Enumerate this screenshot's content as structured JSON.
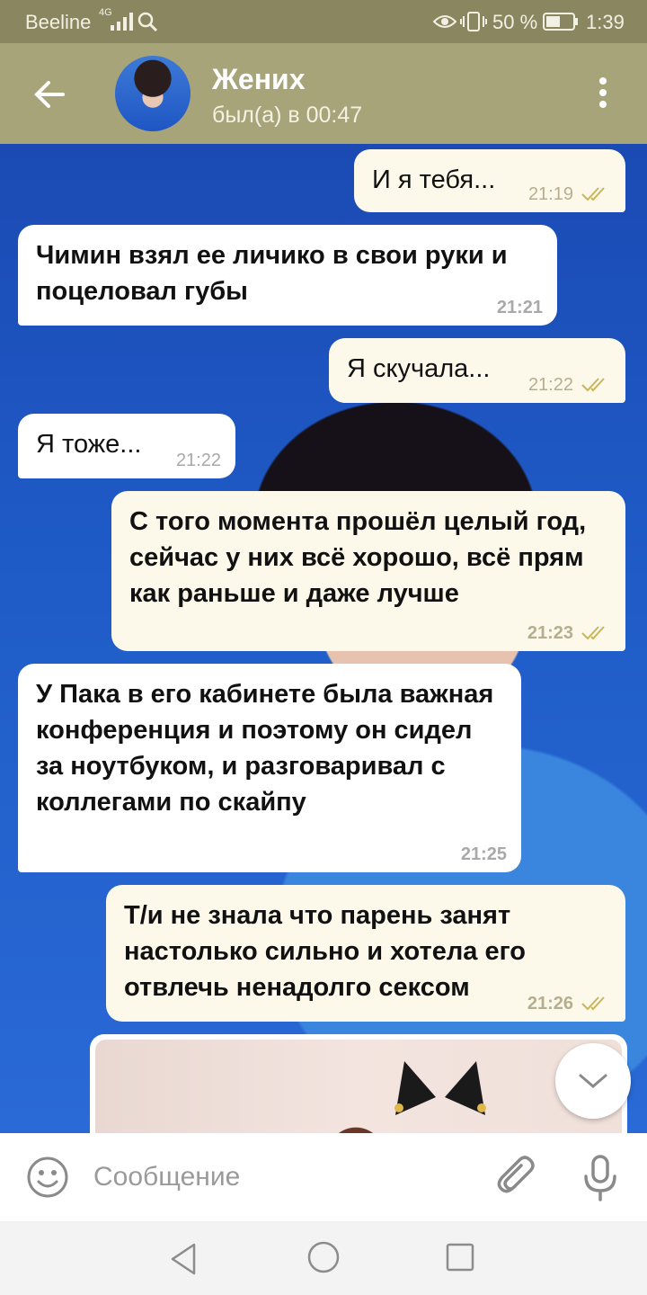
{
  "status_bar": {
    "carrier": "Beeline",
    "network": "4G",
    "battery": "50 %",
    "time": "1:39"
  },
  "header": {
    "name": "Жених",
    "status": "был(а) в 00:47"
  },
  "messages": [
    {
      "side": "out",
      "text": "И я тебя...",
      "time": "21:19",
      "bold": false
    },
    {
      "side": "in",
      "text": "Чимин взял ее личико в свои руки и поцеловал губы",
      "time": "21:21",
      "bold": true
    },
    {
      "side": "out",
      "text": "Я скучала...",
      "time": "21:22",
      "bold": false
    },
    {
      "side": "in",
      "text": "Я тоже...",
      "time": "21:22",
      "bold": false
    },
    {
      "side": "out",
      "text": "С того момента прошёл целый год, сейчас у них всё хорошо, всё прям как раньше и даже лучше",
      "time": "21:23",
      "bold": true
    },
    {
      "side": "in",
      "text": "У Пака в его кабинете была важная конференция и поэтому он сидел за ноутбуком, и разговаривал с коллегами по скайпу",
      "time": "21:25",
      "bold": true
    },
    {
      "side": "out",
      "text": "Т/и не знала что парень занят настолько сильно и хотела его отвлечь ненадолго сексом",
      "time": "21:26",
      "bold": true
    }
  ],
  "input": {
    "placeholder": "Сообщение"
  },
  "icons": {
    "back": "arrow-left-icon",
    "menu": "more-vertical-icon",
    "emoji": "smile-icon",
    "attach": "paperclip-icon",
    "mic": "microphone-icon",
    "scroll_down": "chevron-down-icon"
  },
  "colors": {
    "header": "#a8a47a",
    "status_bar": "#8a8760",
    "incoming_bubble": "#ffffff",
    "outgoing_bubble": "#fdf9ea",
    "read_ticks": "#c9b65a"
  }
}
